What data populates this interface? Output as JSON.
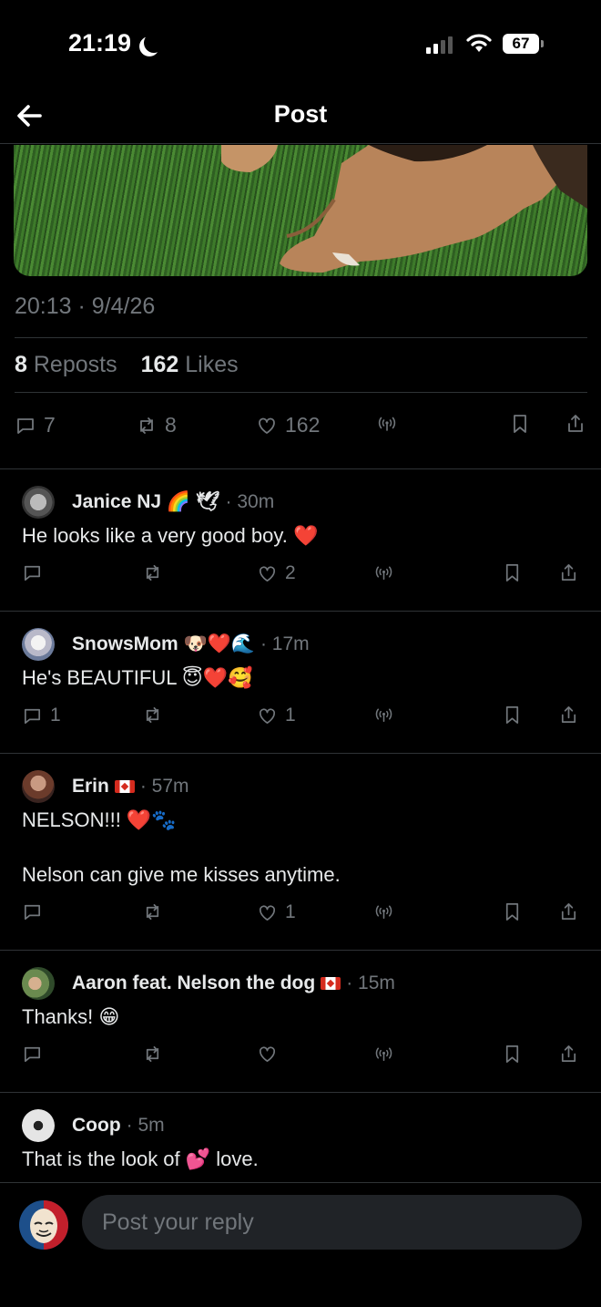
{
  "status_bar": {
    "time": "21:19",
    "battery": "67"
  },
  "header": {
    "title": "Post"
  },
  "post": {
    "timestamp": "20:13 · 9/4/26",
    "reposts_count": "8",
    "reposts_label": "Reposts",
    "likes_count": "162",
    "likes_label": "Likes",
    "actions": {
      "replies": "7",
      "reposts": "8",
      "likes": "162"
    }
  },
  "replies": [
    {
      "name": "Janice NJ 🌈 🕊",
      "time": "· 30m",
      "text": "He looks like a very good boy. ❤️",
      "replies": "",
      "likes": "2"
    },
    {
      "name": "SnowsMom 🐶❤️🌊",
      "time": "· 17m",
      "text": "He's BEAUTIFUL 😇❤️🥰",
      "replies": "1",
      "likes": "1"
    },
    {
      "name": "Erin",
      "time": "· 57m",
      "text": "NELSON!!! ❤️🐾\n\nNelson can give me kisses anytime.",
      "replies": "",
      "likes": "1"
    },
    {
      "name": "Aaron feat. Nelson the dog",
      "time": "· 15m",
      "text": "Thanks! 😁",
      "replies": "",
      "likes": ""
    },
    {
      "name": "Coop",
      "time": "· 5m",
      "text": "That is the look of 💕 love."
    }
  ],
  "composer": {
    "placeholder": "Post your reply"
  },
  "icons": [
    "back-arrow-icon",
    "reply-icon",
    "repost-icon",
    "like-icon",
    "views-icon",
    "bookmark-icon",
    "share-icon"
  ]
}
